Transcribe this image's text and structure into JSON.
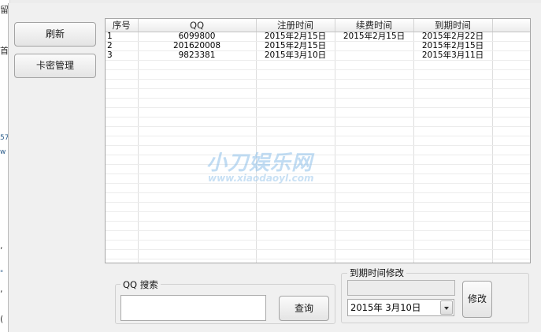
{
  "background_app": {
    "fragments": [
      "留",
      "首",
      "57",
      "w",
      ",",
      "\"",
      ",",
      "("
    ]
  },
  "toolbar": {
    "refresh_label": "刷新",
    "card_mgmt_label": "卡密管理"
  },
  "table": {
    "columns": [
      "序号",
      "QQ",
      "注册时间",
      "续费时间",
      "到期时间",
      ""
    ],
    "rows": [
      [
        "1",
        "6099800",
        "2015年2月15日",
        "2015年2月15日",
        "2015年2月22日"
      ],
      [
        "2",
        "201620008",
        "2015年2月15日",
        "",
        "2015年2月15日"
      ],
      [
        "3",
        "9823381",
        "2015年3月10日",
        "",
        "2015年3月11日"
      ]
    ],
    "empty_rows": 22
  },
  "watermark": {
    "text": "小刀娱乐网",
    "url": "www.xiaodaoyl.com"
  },
  "search": {
    "group_label": "QQ 搜索",
    "input_value": "",
    "button_label": "查询"
  },
  "expiry_edit": {
    "group_label": "到期时间修改",
    "display_value": "",
    "date_value": "2015年  3月10日",
    "button_label": "修改"
  },
  "colors": {
    "window_bg": "#f0f0f0",
    "watermark": "#8fc1ea"
  }
}
